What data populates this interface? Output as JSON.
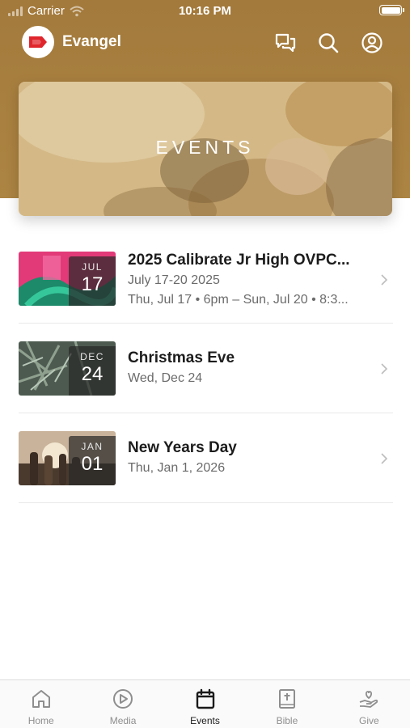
{
  "status_bar": {
    "carrier": "Carrier",
    "time": "10:16 PM"
  },
  "app_bar": {
    "title": "Evangel",
    "icons": [
      "chat-icon",
      "search-icon",
      "profile-icon"
    ]
  },
  "hero": {
    "title": "EVENTS"
  },
  "events": [
    {
      "month": "JUL",
      "day": "17",
      "title": "2025 Calibrate Jr High OVPC...",
      "dates": "July 17-20 2025",
      "time": "Thu, Jul 17 • 6pm – Sun, Jul 20 • 8:3..."
    },
    {
      "month": "DEC",
      "day": "24",
      "title": "Christmas Eve",
      "dates": "Wed, Dec 24"
    },
    {
      "month": "JAN",
      "day": "01",
      "title": "New Years Day",
      "dates": "Thu, Jan 1, 2026"
    }
  ],
  "tabs": [
    {
      "label": "Home",
      "icon": "home-icon"
    },
    {
      "label": "Media",
      "icon": "play-icon"
    },
    {
      "label": "Events",
      "icon": "calendar-icon",
      "active": true
    },
    {
      "label": "Bible",
      "icon": "bible-icon"
    },
    {
      "label": "Give",
      "icon": "give-icon"
    }
  ],
  "colors": {
    "brand": "#a9803f",
    "logo_red": "#e0262d"
  }
}
